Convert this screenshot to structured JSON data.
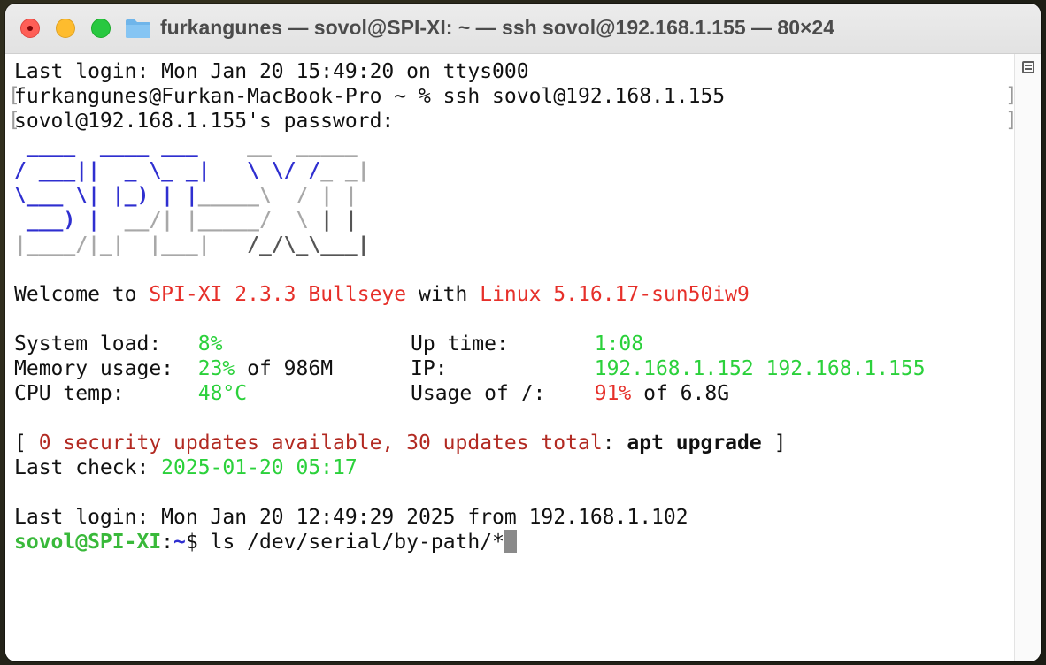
{
  "window": {
    "title": "furkangunes — sovol@SPI-XI: ~ — ssh sovol@192.168.1.155 — 80×24"
  },
  "terminal": {
    "last_login_local": "Last login: Mon Jan 20 15:49:20 on ttys000",
    "local_prompt": "furkangunes@Furkan-MacBook-Pro ~ % ",
    "local_command": "ssh sovol@192.168.1.155",
    "password_prompt": "sovol@192.168.1.155's password:",
    "banner": {
      "line1": {
        "a": " ____  ____ ___",
        "b": "    __  _____"
      },
      "line2": {
        "a": "/ ___|| ",
        "b": " _ \\_ _|",
        "c": "   \\ \\/ /",
        "d": "_ _|"
      },
      "line3": {
        "a": "\\___ \\| |_) | |",
        "b": "_____",
        "c": "\\  / | |"
      },
      "line4": {
        "a": " ___) | ",
        "b": " __/| |_____/  \\ ",
        "c": "| |"
      },
      "line5": {
        "a": "|____/|_|  |___|   ",
        "b": "/_/\\_\\___|"
      }
    },
    "welcome": {
      "prefix": "Welcome to ",
      "distro": "SPI-XI 2.3.3 Bullseye",
      "middle": " with ",
      "kernel": "Linux 5.16.17-sun50iw9"
    },
    "stats": {
      "system_load_label": "System load:   ",
      "system_load_value": "8%",
      "uptime_label": "Up time:       ",
      "uptime_value": "1:08",
      "memory_label": "Memory usage:  ",
      "memory_value": "23%",
      "memory_suffix": " of 986M",
      "ip_label": "IP:            ",
      "ip_value": "192.168.1.152 192.168.1.155",
      "cpu_label": "CPU temp:      ",
      "cpu_value": "48°C",
      "usage_label": "Usage of /:    ",
      "usage_value": "91%",
      "usage_suffix": " of 6.8G"
    },
    "updates": {
      "open": "[ ",
      "count": "0 security updates available, 30 updates total",
      "colon": ": ",
      "command": "apt upgrade",
      "close": " ]"
    },
    "last_check_label": "Last check: ",
    "last_check_value": "2025-01-20 05:17",
    "last_login_remote": "Last login: Mon Jan 20 12:49:29 2025 from 192.168.1.102",
    "remote_prompt_user": "sovol@SPI-XI",
    "remote_prompt_colon": ":",
    "remote_prompt_path": "~",
    "remote_prompt_sign": "$ ",
    "remote_command": "ls /dev/serial/by-path/*"
  },
  "icons": {
    "close": "close-icon",
    "minimize": "minimize-icon",
    "zoom": "zoom-icon",
    "folder": "folder-icon",
    "scroll": "scroll-icon"
  }
}
